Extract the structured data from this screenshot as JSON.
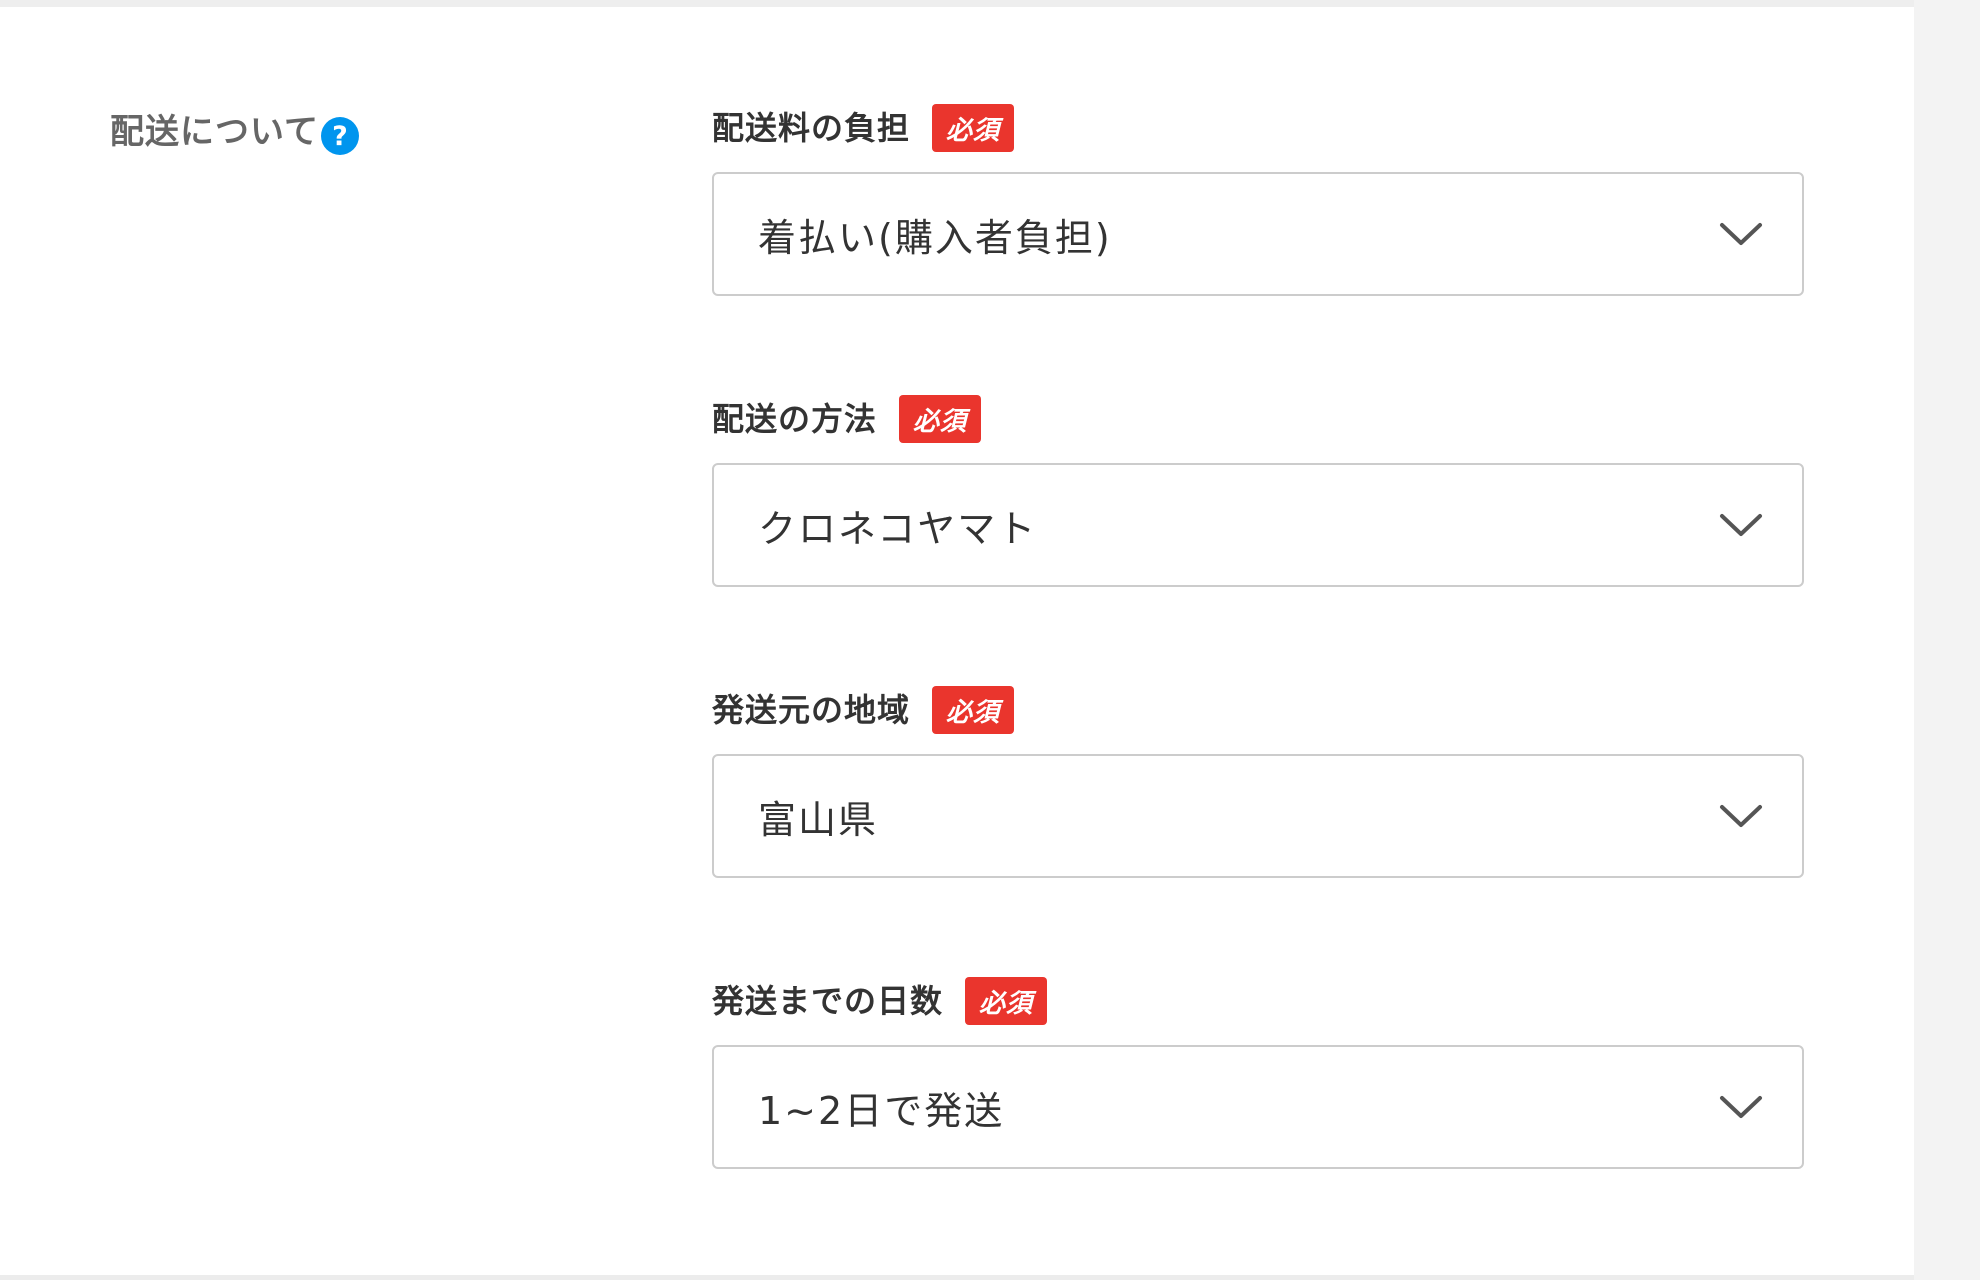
{
  "section": {
    "title": "配送について",
    "help_glyph": "?"
  },
  "fields": [
    {
      "label": "配送料の負担",
      "required_label": "必須",
      "value": "着払い(購入者負担)"
    },
    {
      "label": "配送の方法",
      "required_label": "必須",
      "value": "クロネコヤマト"
    },
    {
      "label": "発送元の地域",
      "required_label": "必須",
      "value": "富山県"
    },
    {
      "label": "発送までの日数",
      "required_label": "必須",
      "value": "1~2日で発送"
    }
  ],
  "colors": {
    "required_badge": "#ea352d",
    "help_icon": "#0095ee",
    "border": "#cccccc"
  },
  "icons": {
    "help": "question-circle-icon",
    "dropdown": "chevron-down-icon"
  }
}
